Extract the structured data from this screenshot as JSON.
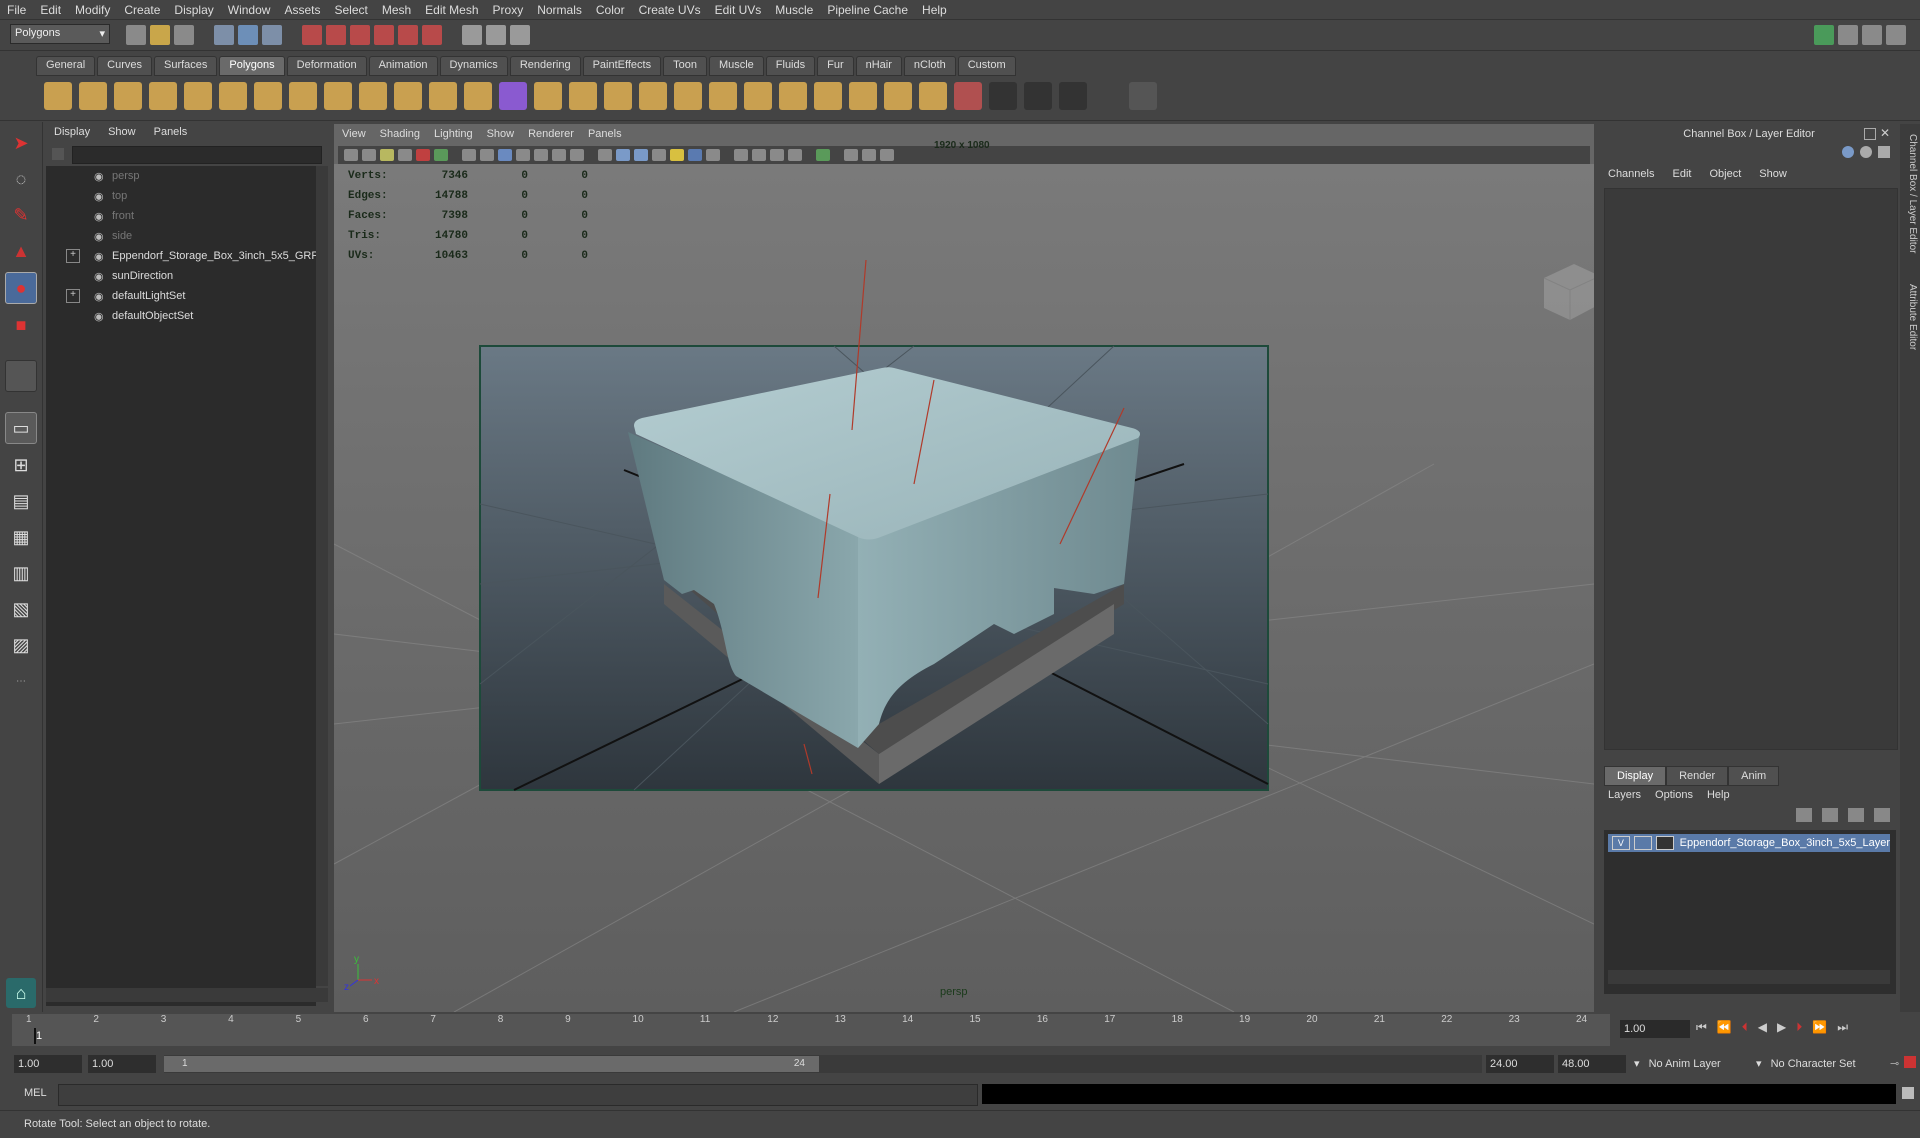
{
  "menubar": [
    "File",
    "Edit",
    "Modify",
    "Create",
    "Display",
    "Window",
    "Assets",
    "Select",
    "Mesh",
    "Edit Mesh",
    "Proxy",
    "Normals",
    "Color",
    "Create UVs",
    "Edit UVs",
    "Muscle",
    "Pipeline Cache",
    "Help"
  ],
  "statusline": {
    "mode": "Polygons"
  },
  "shelf": {
    "tabs": [
      "General",
      "Curves",
      "Surfaces",
      "Polygons",
      "Deformation",
      "Animation",
      "Dynamics",
      "Rendering",
      "PaintEffects",
      "Toon",
      "Muscle",
      "Fluids",
      "Fur",
      "nHair",
      "nCloth",
      "Custom"
    ],
    "active_tab": "Polygons"
  },
  "outliner": {
    "menu": [
      "Display",
      "Show",
      "Panels"
    ],
    "items": [
      {
        "label": "persp",
        "dim": true,
        "expand": ""
      },
      {
        "label": "top",
        "dim": true,
        "expand": ""
      },
      {
        "label": "front",
        "dim": true,
        "expand": ""
      },
      {
        "label": "side",
        "dim": true,
        "expand": ""
      },
      {
        "label": "Eppendorf_Storage_Box_3inch_5x5_GRP",
        "dim": false,
        "expand": "+"
      },
      {
        "label": "sunDirection",
        "dim": false,
        "expand": ""
      },
      {
        "label": "defaultLightSet",
        "dim": false,
        "expand": "+"
      },
      {
        "label": "defaultObjectSet",
        "dim": false,
        "expand": ""
      }
    ]
  },
  "viewport": {
    "menu": [
      "View",
      "Shading",
      "Lighting",
      "Show",
      "Renderer",
      "Panels"
    ],
    "resolution": "1920 x 1080",
    "camera": "persp",
    "hud": [
      {
        "k": "Verts:",
        "a": "7346",
        "b": "0",
        "c": "0"
      },
      {
        "k": "Edges:",
        "a": "14788",
        "b": "0",
        "c": "0"
      },
      {
        "k": "Faces:",
        "a": "7398",
        "b": "0",
        "c": "0"
      },
      {
        "k": "Tris:",
        "a": "14780",
        "b": "0",
        "c": "0"
      },
      {
        "k": "UVs:",
        "a": "10463",
        "b": "0",
        "c": "0"
      }
    ]
  },
  "channelbox": {
    "title": "Channel Box / Layer Editor",
    "menu": [
      "Channels",
      "Edit",
      "Object",
      "Show"
    ],
    "layer_tabs": [
      "Display",
      "Render",
      "Anim"
    ],
    "layer_menu": [
      "Layers",
      "Options",
      "Help"
    ],
    "layer": {
      "visible": "V",
      "name": "Eppendorf_Storage_Box_3inch_5x5_Layer"
    },
    "side_tabs": [
      "Channel Box / Layer Editor",
      "Attribute Editor"
    ]
  },
  "timeline": {
    "ticks": [
      "1",
      "2",
      "3",
      "4",
      "5",
      "6",
      "7",
      "8",
      "9",
      "10",
      "11",
      "12",
      "13",
      "14",
      "15",
      "16",
      "17",
      "18",
      "19",
      "20",
      "21",
      "22",
      "23",
      "24"
    ],
    "current_frame": "1.00",
    "current_marker": "1"
  },
  "range": {
    "start": "1.00",
    "start2": "1.00",
    "slider_start": "1",
    "slider_end": "24",
    "end": "24.00",
    "end2": "48.00",
    "anim_layer": "No Anim Layer",
    "char_set": "No Character Set"
  },
  "cmdline": {
    "label": "MEL"
  },
  "help": {
    "text": "Rotate Tool: Select an object to rotate."
  },
  "colors": {
    "accent": "#5a7aa8",
    "viewport_bg_top": "#6b6b6b",
    "box_top": "#a9c3c7",
    "box_side": "#7f9ca1",
    "box_base": "#5d5d5d"
  }
}
